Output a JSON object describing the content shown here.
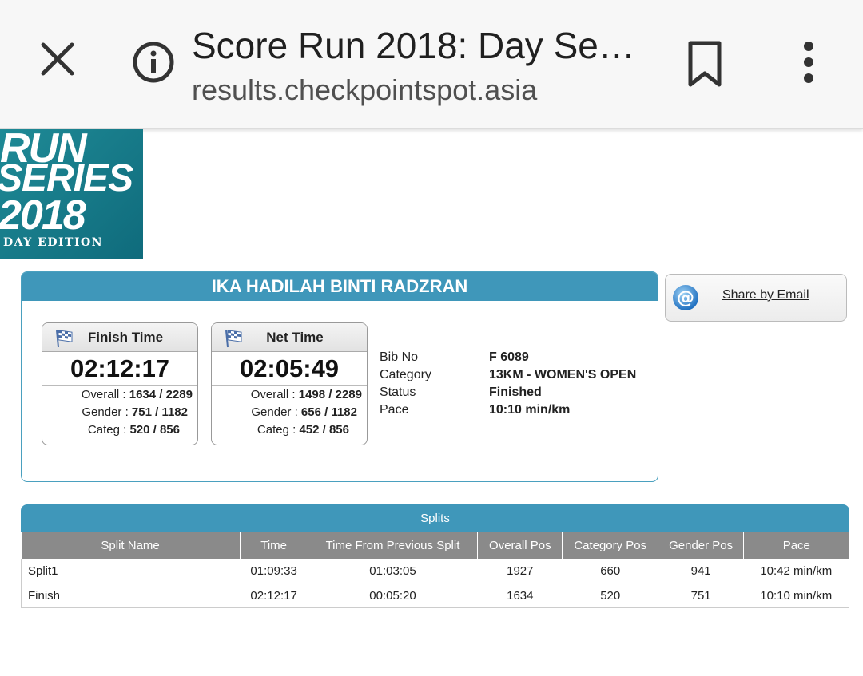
{
  "browser": {
    "title": "Score Run 2018: Day Se…",
    "url": "results.checkpointspot.asia",
    "icons": [
      "close-icon",
      "info-icon",
      "bookmark-icon",
      "more-vert-icon"
    ]
  },
  "banner": {
    "line1": "RUN",
    "line2": "SERIES",
    "line3": "2018",
    "line4": "DAY EDITION"
  },
  "result": {
    "name": "IKA HADILAH BINTI RADZRAN",
    "finish": {
      "label": "Finish Time",
      "time": "02:12:17",
      "overall_label": "Overall : ",
      "overall": "1634 / 2289",
      "gender_label": "Gender : ",
      "gender": "751 / 1182",
      "categ_label": "Categ : ",
      "categ": "520 / 856"
    },
    "net": {
      "label": "Net Time",
      "time": "02:05:49",
      "overall_label": "Overall : ",
      "overall": "1498 / 2289",
      "gender_label": "Gender : ",
      "gender": "656 / 1182",
      "categ_label": "Categ : ",
      "categ": "452 / 856"
    },
    "info": [
      {
        "key": "Bib No",
        "value": "F 6089"
      },
      {
        "key": "Category",
        "value": "13KM - WOMEN'S OPEN"
      },
      {
        "key": "Status",
        "value": "Finished"
      },
      {
        "key": "Pace",
        "value": "10:10 min/km"
      }
    ]
  },
  "share": {
    "label": "Share by Email",
    "icon": "email-at-icon"
  },
  "splits": {
    "title": "Splits",
    "columns": [
      "Split Name",
      "Time",
      "Time From Previous Split",
      "Overall Pos",
      "Category Pos",
      "Gender Pos",
      "Pace"
    ],
    "rows": [
      [
        "Split1",
        "01:09:33",
        "01:03:05",
        "1927",
        "660",
        "941",
        "10:42 min/km"
      ],
      [
        "Finish",
        "02:12:17",
        "00:05:20",
        "1634",
        "520",
        "751",
        "10:10 min/km"
      ]
    ]
  },
  "colors": {
    "accent": "#3f97ba",
    "header_gray": "#8a8a8a",
    "banner": "#1a7f8e"
  }
}
